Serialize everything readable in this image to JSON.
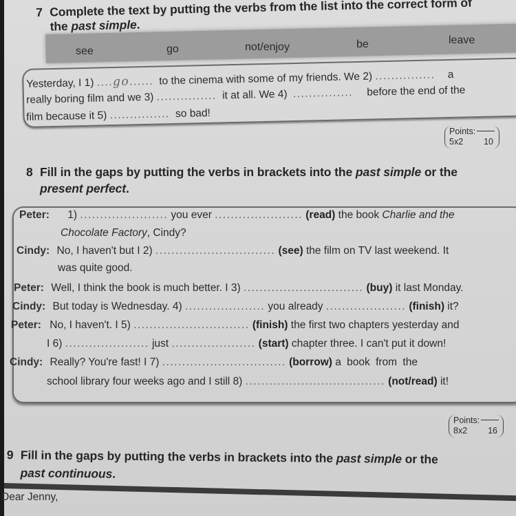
{
  "exercise7": {
    "number": "7",
    "instruction_line1": "Complete the text by putting the verbs from the list into the correct form of",
    "instruction_line2_pre": "the ",
    "instruction_line2_italic": "past simple",
    "instruction_line2_post": ".",
    "word_list": [
      "see",
      "go",
      "not/enjoy",
      "be",
      "leave"
    ],
    "text_lines": [
      {
        "a": "Yesterday, I 1)",
        "handwritten": "go",
        "b": "to the cinema with some of my friends. We 2)",
        "c": "a"
      },
      {
        "a": "really boring film and we 3)",
        "b": "it at all. We 4)",
        "c": "before the end of the"
      },
      {
        "a": "film because it 5)",
        "b": "so bad!"
      }
    ],
    "points": {
      "label": "Points:",
      "formula": "5x2",
      "total": "10"
    }
  },
  "exercise8": {
    "number": "8",
    "instruction_pre": "Fill in the gaps by putting the verbs in brackets into the ",
    "instruction_italic1": "past simple",
    "instruction_mid": " or the",
    "instruction_line2_italic": "present perfect",
    "instruction_line2_post": ".",
    "dialogue": [
      {
        "speaker": "Peter:",
        "t1": "1)",
        "t2": "you ever",
        "verb": "(read)",
        "t3": "the book",
        "t4_italic": "Charlie and the"
      },
      {
        "t_italic": "Chocolate Factory",
        "t": ", Cindy?"
      },
      {
        "speaker": "Cindy:",
        "t1": "No, I haven't but I 2)",
        "verb": "(see)",
        "t3": "the film on TV last weekend. It"
      },
      {
        "t": "was quite good."
      },
      {
        "speaker": "Peter:",
        "t1": "Well, I think the book is much better. I 3)",
        "verb": "(buy)",
        "t3": "it last Monday."
      },
      {
        "speaker": "Cindy:",
        "t1": "But today is Wednesday. 4)",
        "t2": "you already",
        "verb": "(finish)",
        "t3": "it?"
      },
      {
        "speaker": "Peter:",
        "t1": "No, I haven't. I 5)",
        "verb": "(finish)",
        "t3": "the first two chapters yesterday and"
      },
      {
        "t1": "I 6)",
        "t2": "just",
        "verb": "(start)",
        "t3": "chapter three. I can't put it down!"
      },
      {
        "speaker": "Cindy:",
        "t1": "Really? You're fast! I 7)",
        "verb": "(borrow)",
        "t3": "a book from the"
      },
      {
        "t1": "school library four weeks ago and I still 8)",
        "verb": "(not/read)",
        "t3": "it!"
      }
    ],
    "points": {
      "label": "Points:",
      "formula": "8x2",
      "total": "16"
    }
  },
  "exercise9": {
    "number": "9",
    "instruction_pre": "Fill in the gaps by putting the verbs in brackets into the ",
    "instruction_italic1": "past simple",
    "instruction_mid": " or the",
    "instruction_line2_italic": "past continuous",
    "instruction_line2_post": ".",
    "letter_greeting": "Dear Jenny,"
  }
}
